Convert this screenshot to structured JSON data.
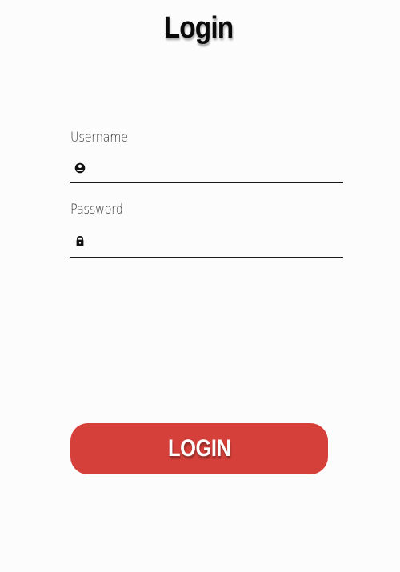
{
  "header": {
    "title": "Login"
  },
  "form": {
    "username": {
      "label": "Username",
      "value": "",
      "placeholder": "",
      "icon": "account-circle-icon"
    },
    "password": {
      "label": "Password",
      "value": "",
      "placeholder": "",
      "icon": "lock-icon"
    },
    "submit_label": "LOGIN"
  },
  "colors": {
    "background": "#fdfcfc",
    "accent": "#d6403a",
    "text": "#0a0a0a",
    "button_text": "#ffffff"
  }
}
